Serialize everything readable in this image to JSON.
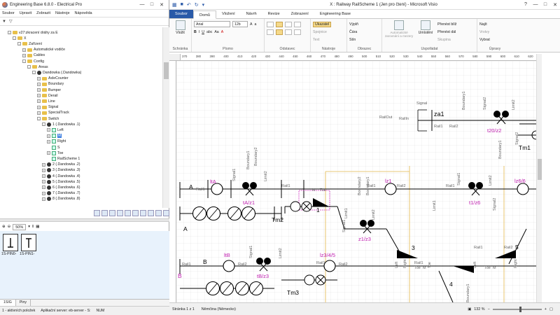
{
  "eb": {
    "title": "Engineering Base 6.8.0 - Electrical Pro",
    "menu": [
      "Soubor",
      "Upravit",
      "Zobrazit",
      "Nástroje",
      "Nápověda"
    ],
    "tree": [
      {
        "label": "v27:zkracení dráhy za E",
        "level": 1,
        "exp": "-",
        "icon": "folder"
      },
      {
        "label": "X",
        "level": 2,
        "exp": "-",
        "icon": "folder"
      },
      {
        "label": "Zařízení",
        "level": 3,
        "exp": "-",
        "icon": "folder"
      },
      {
        "label": "Automatické vodiče",
        "level": 4,
        "exp": "+",
        "icon": "folder"
      },
      {
        "label": "Cables",
        "level": 4,
        "exp": "+",
        "icon": "folder"
      },
      {
        "label": "Config",
        "level": 4,
        "exp": "-",
        "icon": "folder"
      },
      {
        "label": "Areas",
        "level": 5,
        "exp": "-",
        "icon": "folder"
      },
      {
        "label": "Dandowka  (.Dandowka)",
        "level": 6,
        "exp": "-",
        "icon": "station"
      },
      {
        "label": "AxleCounter",
        "level": 7,
        "exp": "+",
        "icon": "folder"
      },
      {
        "label": "Boundary",
        "level": 7,
        "exp": "+",
        "icon": "folder"
      },
      {
        "label": "Bumper",
        "level": 7,
        "exp": "+",
        "icon": "folder"
      },
      {
        "label": "Derail",
        "level": 7,
        "exp": "+",
        "icon": "folder"
      },
      {
        "label": "Line",
        "level": 7,
        "exp": "+",
        "icon": "folder"
      },
      {
        "label": "Signal",
        "level": 7,
        "exp": "+",
        "icon": "folder"
      },
      {
        "label": "SpecialTrack",
        "level": 7,
        "exp": "+",
        "icon": "folder"
      },
      {
        "label": "Switch",
        "level": 7,
        "exp": "-",
        "icon": "folder"
      },
      {
        "label": "1  (.Dandowka .1)",
        "level": 8,
        "exp": "-",
        "icon": "station"
      },
      {
        "label": "Left",
        "level": 9,
        "exp": "+",
        "icon": "dev"
      },
      {
        "label": "M",
        "level": 9,
        "exp": "+",
        "icon": "dev",
        "selected": true
      },
      {
        "label": "Right",
        "level": 9,
        "exp": "+",
        "icon": "dev"
      },
      {
        "label": "S",
        "level": 9,
        "exp": "",
        "icon": "dev"
      },
      {
        "label": "Toe",
        "level": 9,
        "exp": "+",
        "icon": "dev"
      },
      {
        "label": "RailScheme 1",
        "level": 9,
        "exp": "",
        "icon": "dev"
      },
      {
        "label": "2  (.Dandowka .2)",
        "level": 8,
        "exp": "+",
        "icon": "station"
      },
      {
        "label": "3  (.Dandowka .3)",
        "level": 8,
        "exp": "+",
        "icon": "station"
      },
      {
        "label": "4  (.Dandowka .4)",
        "level": 8,
        "exp": "+",
        "icon": "station"
      },
      {
        "label": "5  (.Dandowka .5)",
        "level": 8,
        "exp": "+",
        "icon": "station"
      },
      {
        "label": "6  (.Dandowka .6)",
        "level": 8,
        "exp": "+",
        "icon": "station"
      },
      {
        "label": "7  (.Dandowka .7)",
        "level": 8,
        "exp": "+",
        "icon": "station"
      },
      {
        "label": "8  (.Dandowka .8)",
        "level": 8,
        "exp": "+",
        "icon": "station"
      }
    ],
    "zoom": "50%",
    "pins": [
      "1S-PIN0-",
      "1S-PIN1-"
    ],
    "lower_tabs": [
      "1SIG",
      "Piny"
    ],
    "status": [
      "1 - aktivních položek",
      "Aplikační server: eb-server - S:",
      "NUM"
    ]
  },
  "visio": {
    "title": "X : Railway RailScheme 1 (Jen pro čtení)  -  Microsoft Visio",
    "tabs": [
      "Soubor",
      "Domů",
      "Vložení",
      "Návrh",
      "Revize",
      "Zobrazení",
      "Engineering Base"
    ],
    "active_tab": "Domů",
    "ribbon": {
      "paste": "Vložit",
      "font_name": "Arial",
      "font_size": "12b",
      "pointer": "Ukazatel",
      "connector": "Spojnice",
      "text": "Text",
      "fill": "Výplň",
      "line": "Čára",
      "shadow": "Stín",
      "auto_align": "Automatické zarovnání a mezery",
      "position": "Umístění",
      "bring_forward": "Přenést blíž",
      "send_back": "Přenést dál",
      "group": "Skupina",
      "find": "Najít",
      "layers": "Vrstvy",
      "select": "Vybrat",
      "groups": [
        "Schránka",
        "Písmo",
        "Odstavec",
        "Nástroje",
        "Obrazec",
        "Uspořádat",
        "Úpravy"
      ]
    },
    "ruler_ticks": [
      "370",
      "380",
      "390",
      "400",
      "410",
      "420",
      "430",
      "440",
      "450",
      "460",
      "470",
      "480",
      "490",
      "500",
      "510",
      "520",
      "530",
      "540",
      "550",
      "560",
      "570",
      "580",
      "590",
      "600",
      "610",
      "620"
    ],
    "status": {
      "page": "Stránka 1 z 1",
      "language": "Němčina (Německo)",
      "zoom": "132 %"
    }
  },
  "scheme": {
    "magenta_labels": [
      "za1",
      "t20/z2",
      "ltA",
      "tA/z1",
      "lz1",
      "t1/z6",
      "lz6/6",
      "z1/z3",
      "ltB",
      "tB/z3",
      "lz3/4/5"
    ],
    "black_labels": [
      "Tm1",
      "Tm2",
      "Tm3",
      "A",
      "A",
      "B",
      "B",
      "1",
      "3",
      "4",
      "5",
      "Signal",
      "RailOut",
      "RailIn",
      "Rail1",
      "Rail2",
      "Boundary1",
      "Boundary2",
      "Limit1",
      "Limit2",
      "Signal1",
      "Signal2",
      "Left",
      "Right",
      "Toe",
      "M",
      "S"
    ]
  }
}
